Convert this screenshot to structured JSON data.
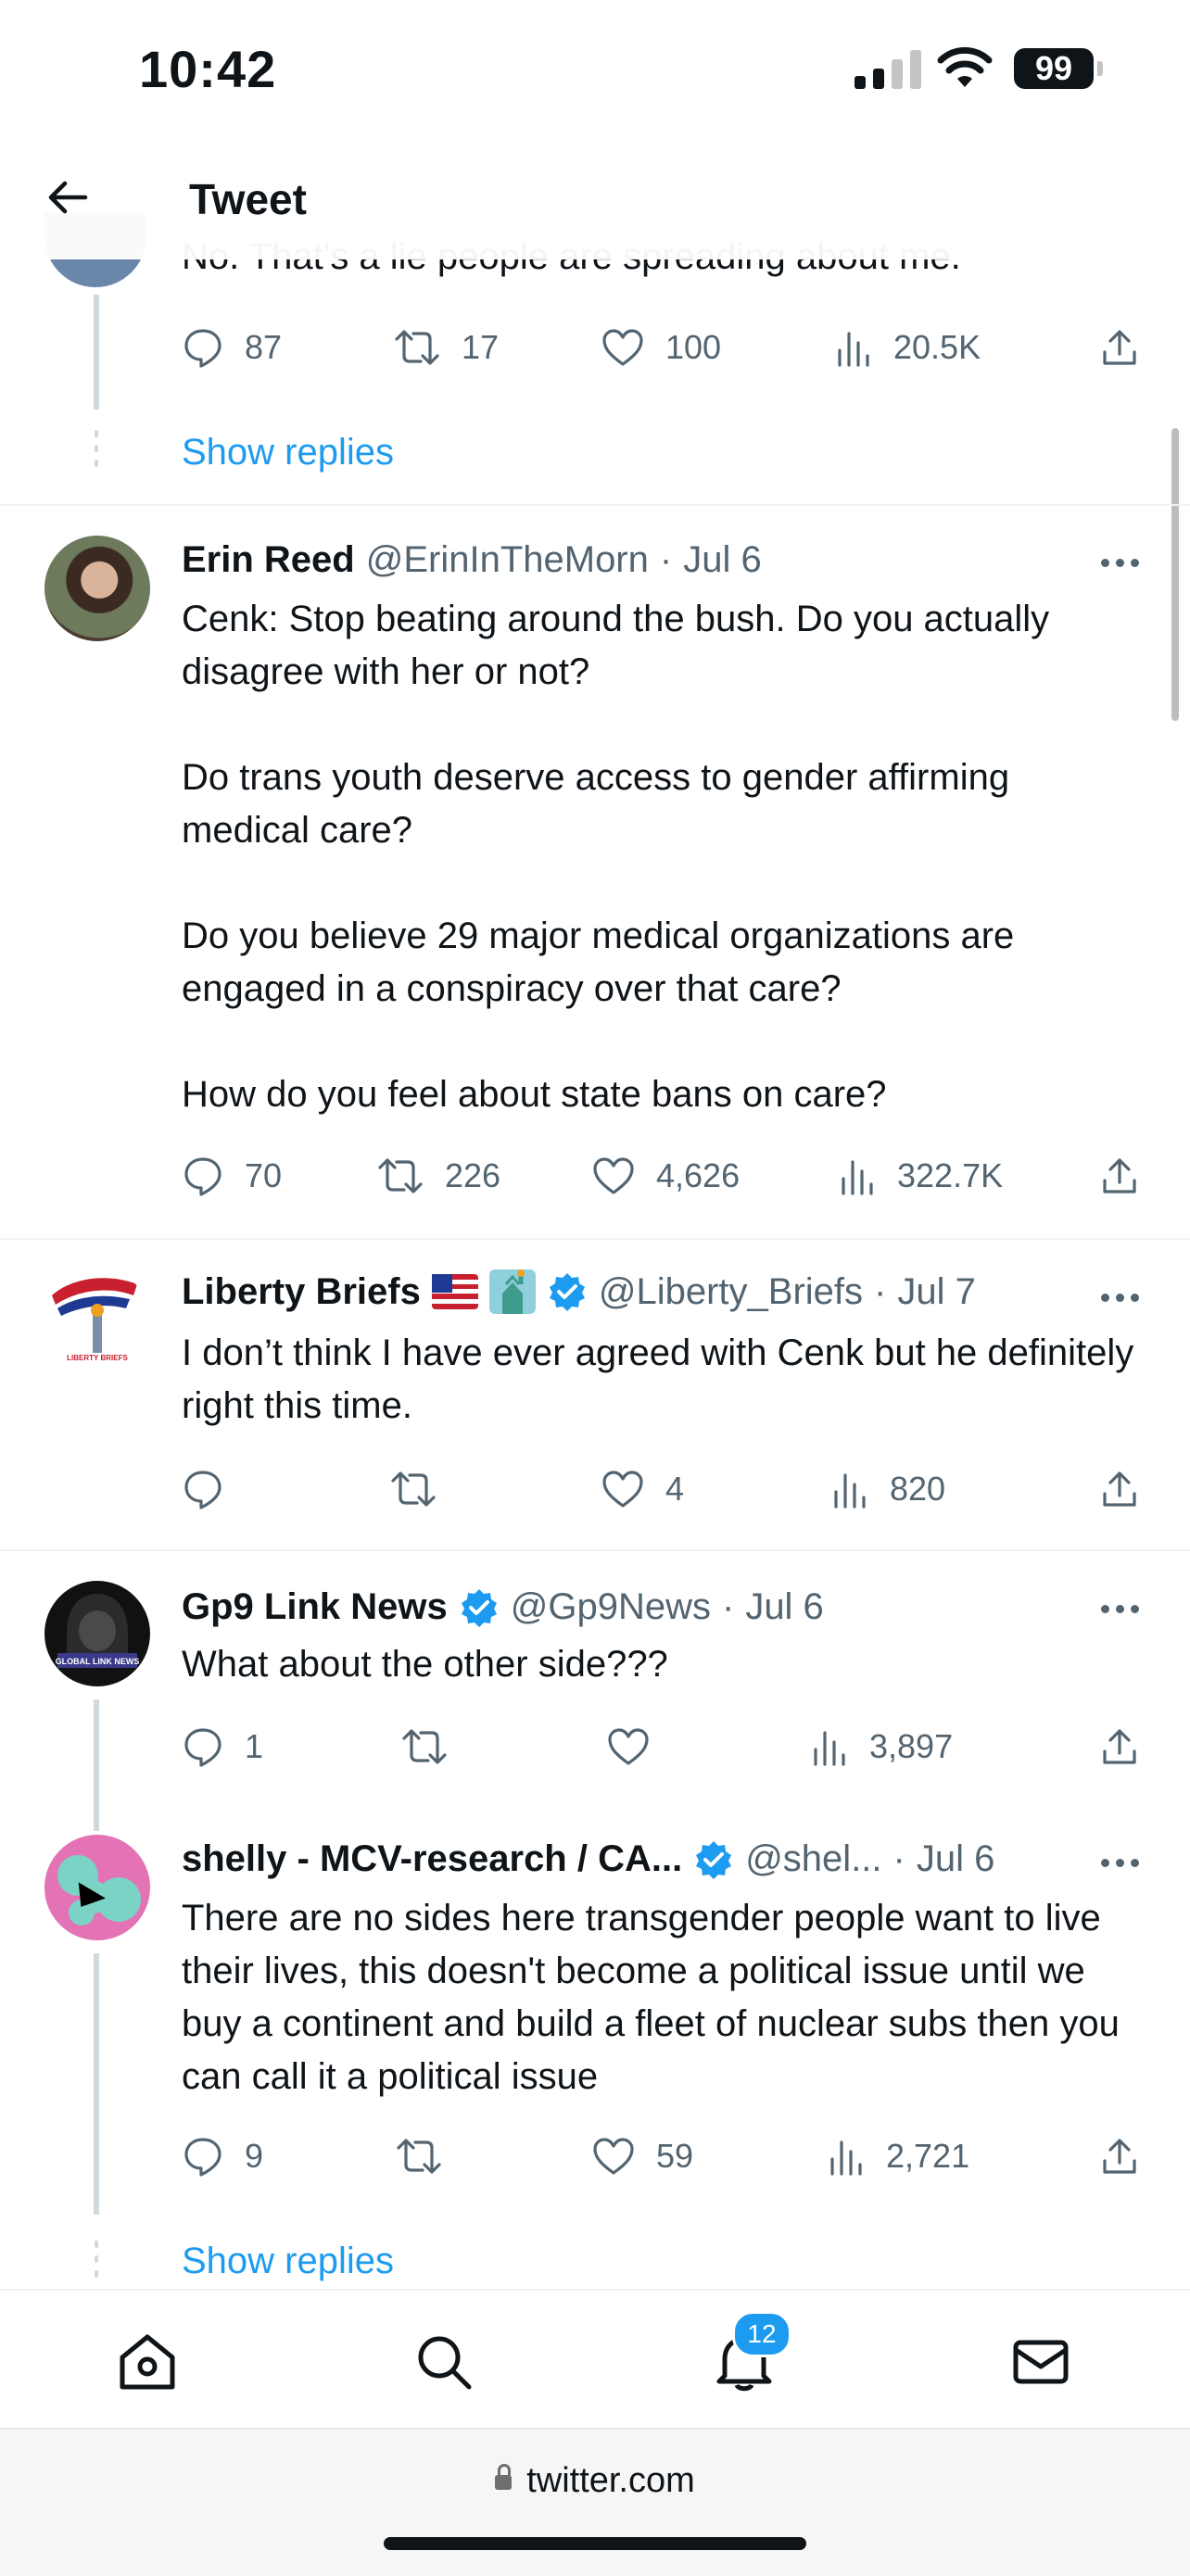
{
  "status_bar": {
    "time": "10:42",
    "battery": "99"
  },
  "header": {
    "title": "Tweet"
  },
  "clipped_text": "No. That's a lie people are spreading about me.",
  "first_actions": {
    "replies": "87",
    "retweets": "17",
    "likes": "100",
    "views": "20.5K"
  },
  "show_replies_label": "Show replies",
  "tweets": [
    {
      "name": "Erin Reed",
      "handle": "@ErinInTheMorn",
      "sep": "·",
      "date": "Jul 6",
      "text": "Cenk: Stop beating around the bush. Do you actually disagree with her or not?\n\nDo trans youth deserve access to gender affirming medical care?\n\nDo you believe 29 major medical organizations are engaged in a conspiracy over that care?\n\nHow do you feel about state bans on care?",
      "replies": "70",
      "retweets": "226",
      "likes": "4,626",
      "views": "322.7K"
    },
    {
      "name": "Liberty Briefs",
      "handle": "@Liberty_Briefs",
      "sep": "·",
      "date": "Jul 7",
      "logo_text": "LIBERTY BRIEFS",
      "text": "I don’t think I have ever agreed with Cenk but he definitely right this time.",
      "replies": "",
      "retweets": "",
      "likes": "4",
      "views": "820"
    },
    {
      "name": "Gp9 Link News",
      "handle": "@Gp9News",
      "sep": "·",
      "date": "Jul 6",
      "logo_text": "GLOBAL LINK NEWS",
      "text": "What about the other side???",
      "replies": "1",
      "retweets": "",
      "likes": "",
      "views": "3,897"
    },
    {
      "name": "shelly - MCV-research / CA...",
      "handle": "@shel...",
      "sep": "·",
      "date": "Jul 6",
      "text": "There are no sides here transgender people want to live their lives, this doesn't become a political issue until we buy a continent and build a fleet of nuclear subs then you can call it a political issue",
      "replies": "9",
      "retweets": "",
      "likes": "59",
      "views": "2,721"
    }
  ],
  "tab_bar": {
    "notifications_badge": "12"
  },
  "browser": {
    "url": "twitter.com"
  },
  "colors": {
    "accent": "#1d9bf0",
    "text": "#0f1419",
    "muted": "#536471",
    "line": "#cfd9de"
  }
}
